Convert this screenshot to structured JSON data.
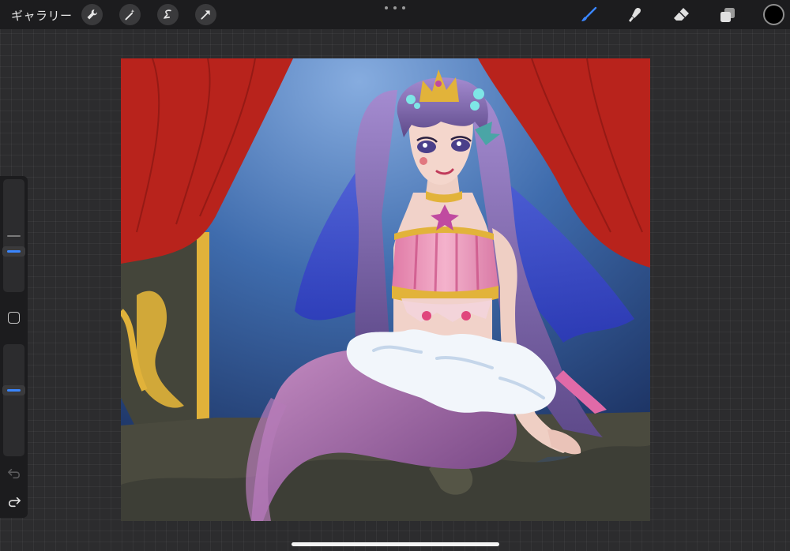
{
  "topbar": {
    "gallery_label": "ギャラリー",
    "left_tools": [
      "wrench-icon",
      "magic-wand-icon",
      "selection-icon",
      "transform-arrow-icon"
    ],
    "right_tools": [
      "brush-icon",
      "smudge-icon",
      "eraser-icon",
      "layers-icon"
    ],
    "active_tool": "brush-icon",
    "accent_color": "#3a86ff",
    "current_color": "#000000"
  },
  "sidebar": {
    "brush_size_slider": "slider",
    "opacity_slider": "slider",
    "modify_button": "square-icon",
    "undo": "undo-icon",
    "redo": "redo-icon"
  },
  "canvas": {
    "artwork": "mermaid-princess-illustration",
    "palette": {
      "curtain": "#b8231c",
      "background_top": "#7ea6dc",
      "background_bottom": "#1d3768",
      "hair": "#8a6fb8",
      "gold": "#e2b33a",
      "top": "#e68fb4",
      "tail": "#9a5fa0",
      "fur": "#f2f6fb"
    }
  }
}
